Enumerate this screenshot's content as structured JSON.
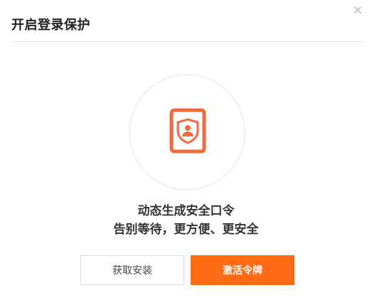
{
  "dialog": {
    "title": "开启登录保护",
    "close_icon": "close-icon"
  },
  "hero": {
    "icon": "shield-user-icon",
    "accent_color": "#ff6a13",
    "headline": "动态生成安全口令",
    "subline": "告别等待，更方便、更安全"
  },
  "buttons": {
    "get_install_label": "获取安装",
    "activate_label": "激活令牌"
  }
}
